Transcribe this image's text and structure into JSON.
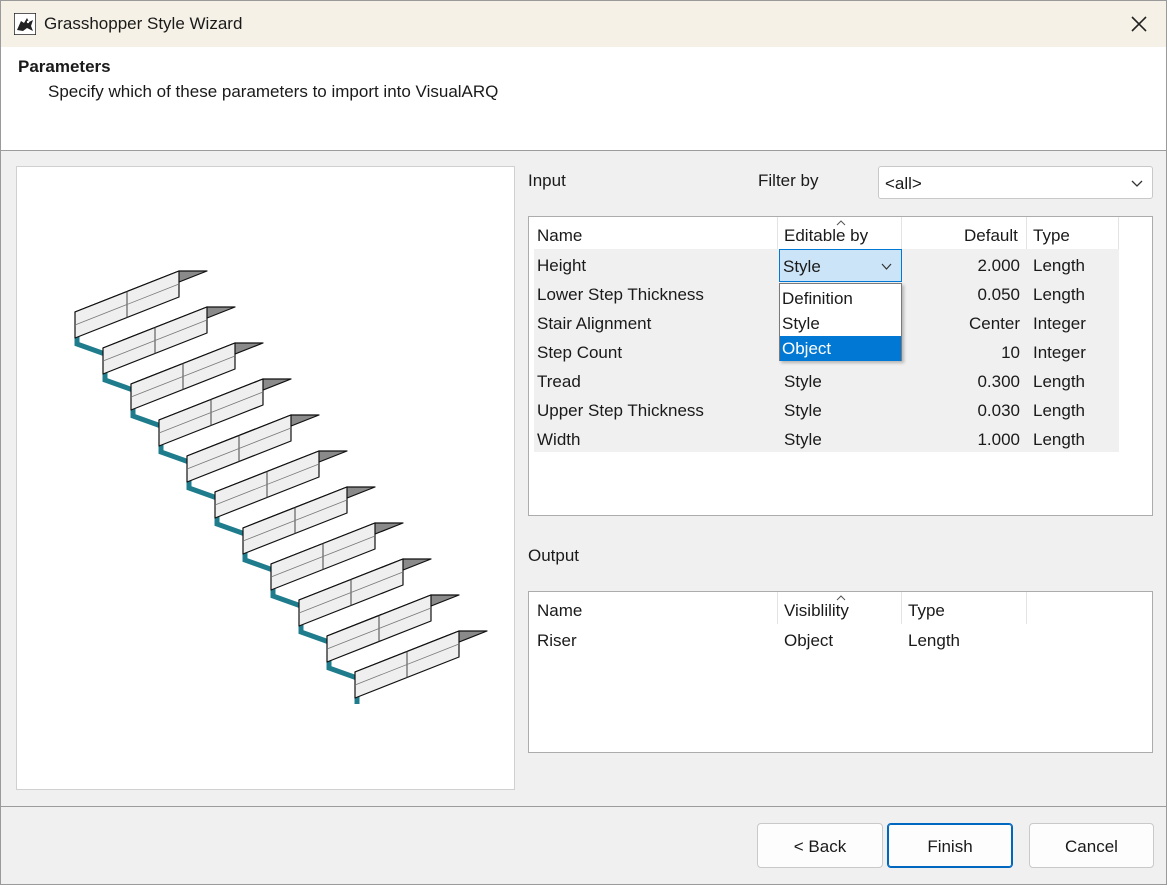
{
  "window": {
    "title": "Grasshopper Style Wizard"
  },
  "header": {
    "title": "Parameters",
    "subtitle": "Specify which of these parameters to import into VisualARQ"
  },
  "input": {
    "label": "Input",
    "filter_label": "Filter by",
    "filter_value": "<all>",
    "columns": [
      "Name",
      "Editable by",
      "Default",
      "Type"
    ],
    "rows": [
      {
        "name": "Height",
        "editable_by": "Style",
        "default": "2.000",
        "type": "Length"
      },
      {
        "name": "Lower Step Thickness",
        "editable_by": "",
        "default": "0.050",
        "type": "Length"
      },
      {
        "name": "Stair Alignment",
        "editable_by": "",
        "default": "Center",
        "type": "Integer"
      },
      {
        "name": "Step Count",
        "editable_by": "",
        "default": "10",
        "type": "Integer"
      },
      {
        "name": "Tread",
        "editable_by": "Style",
        "default": "0.300",
        "type": "Length"
      },
      {
        "name": "Upper Step Thickness",
        "editable_by": "Style",
        "default": "0.030",
        "type": "Length"
      },
      {
        "name": "Width",
        "editable_by": "Style",
        "default": "1.000",
        "type": "Length"
      }
    ],
    "dropdown": {
      "selected": "Style",
      "options": [
        "Definition",
        "Style",
        "Object"
      ],
      "highlighted": "Object"
    }
  },
  "output": {
    "label": "Output",
    "columns": [
      "Name",
      "Visiblility",
      "Type"
    ],
    "rows": [
      {
        "name": "Riser",
        "visibility": "Object",
        "type": "Length"
      }
    ]
  },
  "buttons": {
    "back": "< Back",
    "finish": "Finish",
    "cancel": "Cancel"
  },
  "colors": {
    "accent": "#0078d4",
    "titlebar": "#f6f1e6",
    "selection": "#cce4f7"
  },
  "icons": {
    "app": "rhino-icon",
    "close": "close-icon",
    "chevron": "chevron-down-icon",
    "sort": "sort-caret-icon"
  }
}
